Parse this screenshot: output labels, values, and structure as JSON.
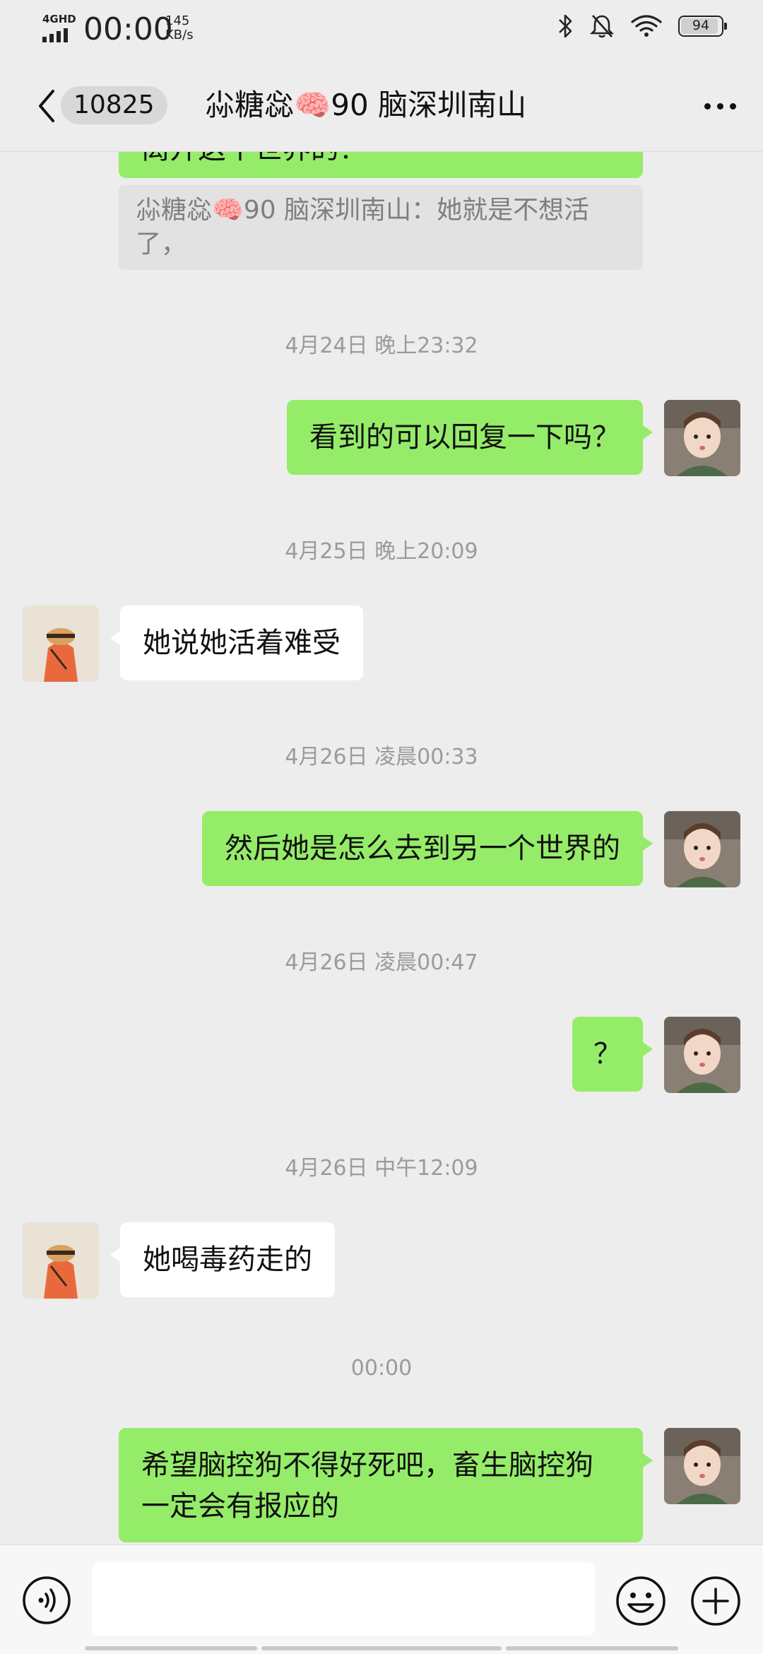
{
  "status_bar": {
    "network": "4GHD",
    "time": "00:00",
    "speed_value": "145",
    "speed_unit": "KB/s",
    "battery": "94",
    "battery_level": 0.94
  },
  "header": {
    "unread_count": "10825",
    "title": "尛糖惢🧠90 脑深圳南山"
  },
  "messages": {
    "top_partial_text": "离开这个世界的？",
    "quote_text": "尛糖惢🧠90 脑深圳南山：她就是不想活了，",
    "ts1": "4月24日 晚上23:32",
    "m1": "看到的可以回复一下吗？",
    "ts2": "4月25日 晚上20:09",
    "m2": "她说她活着难受",
    "ts3": "4月26日 凌晨00:33",
    "m3": "然后她是怎么去到另一个世界的",
    "ts4": "4月26日 凌晨00:47",
    "m4": "？",
    "ts5": "4月26日 中午12:09",
    "m5": "她喝毒药走的",
    "ts6": "00:00",
    "m6": "希望脑控狗不得好死吧，畜生脑控狗一定会有报应的"
  },
  "colors": {
    "outgoing_bubble": "#95ec69",
    "incoming_bubble": "#ffffff",
    "background": "#ededed"
  }
}
